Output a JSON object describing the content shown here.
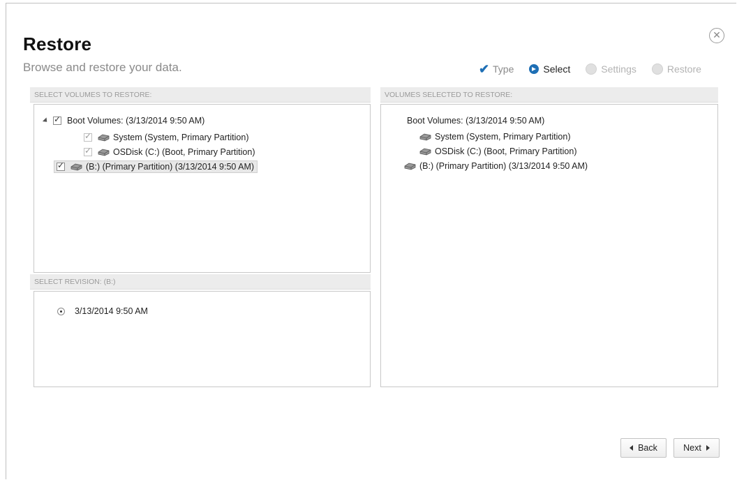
{
  "header": {
    "title": "Restore",
    "subtitle": "Browse and restore your data.",
    "close_icon": "close-circle-icon"
  },
  "steps": [
    {
      "label": "Type",
      "state": "done",
      "icon": "checkmark-icon"
    },
    {
      "label": "Select",
      "state": "active",
      "icon": "arrow-circle-icon"
    },
    {
      "label": "Settings",
      "state": "todo",
      "icon": "circle-icon"
    },
    {
      "label": "Restore",
      "state": "todo",
      "icon": "circle-icon"
    }
  ],
  "select_volumes": {
    "header": "SELECT VOLUMES TO RESTORE:",
    "tree": [
      {
        "label": "Boot Volumes: (3/13/2014 9:50 AM)",
        "checked": true,
        "expanded": true
      },
      {
        "label": "System (System, Primary Partition)",
        "checked": true
      },
      {
        "label": "OSDisk (C:) (Boot, Primary Partition)",
        "checked": true
      },
      {
        "label": "(B:) (Primary Partition) (3/13/2014 9:50 AM)",
        "checked": true,
        "selected": true
      }
    ]
  },
  "select_revision": {
    "header": "SELECT REVISION:  (B:)",
    "options": [
      {
        "label": "3/13/2014 9:50 AM",
        "selected": true
      }
    ]
  },
  "volumes_selected": {
    "header": "VOLUMES SELECTED TO RESTORE:",
    "items": [
      {
        "label": "Boot Volumes: (3/13/2014 9:50 AM)"
      },
      {
        "label": "System (System, Primary Partition)"
      },
      {
        "label": "OSDisk (C:) (Boot, Primary Partition)"
      },
      {
        "label": "(B:) (Primary Partition) (3/13/2014 9:50 AM)"
      }
    ]
  },
  "footer": {
    "back_label": "Back",
    "next_label": "Next"
  },
  "colors": {
    "accent": "#1e6fb5",
    "panel_header_bg": "#ececec",
    "muted_text": "#9a9a9a"
  }
}
